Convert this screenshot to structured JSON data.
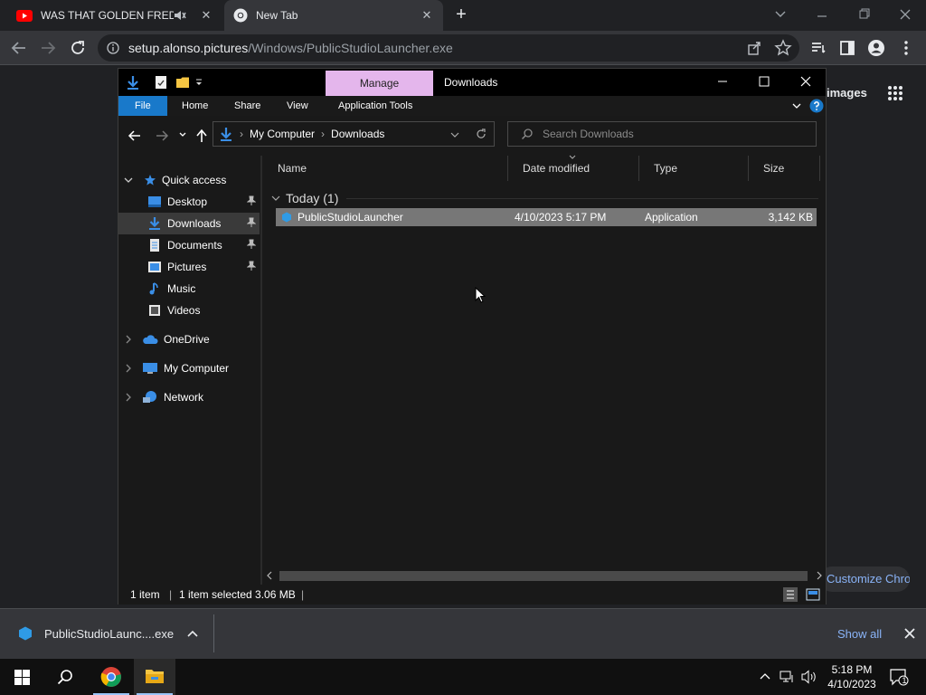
{
  "chrome": {
    "tabs": [
      {
        "title": "WAS THAT GOLDEN FREDDY",
        "close": "✕"
      },
      {
        "title": "New Tab",
        "close": "✕"
      }
    ],
    "new_tab": "+",
    "url_host": "setup.alonso.pictures",
    "url_path": "/Windows/PublicStudioLauncher.exe",
    "images_link": "images",
    "customize_label": "Customize Chrome"
  },
  "explorer": {
    "ribbon_manage": "Manage",
    "title": "Downloads",
    "ribbon_tabs": [
      "File",
      "Home",
      "Share",
      "View",
      "Application Tools"
    ],
    "breadcrumb": [
      "My Computer",
      "Downloads"
    ],
    "search_placeholder": "Search Downloads",
    "nav": {
      "quick_access": "Quick access",
      "items": [
        "Desktop",
        "Downloads",
        "Documents",
        "Pictures",
        "Music",
        "Videos"
      ],
      "onedrive": "OneDrive",
      "my_computer": "My Computer",
      "network": "Network"
    },
    "columns": [
      "Name",
      "Date modified",
      "Type",
      "Size"
    ],
    "group": "Today (1)",
    "file": {
      "name": "PublicStudioLauncher",
      "date": "4/10/2023 5:17 PM",
      "type": "Application",
      "size": "3,142 KB"
    },
    "status": {
      "count": "1 item",
      "selected": "1 item selected  3.06 MB"
    }
  },
  "download_shelf": {
    "file": "PublicStudioLaunc....exe",
    "show_all": "Show all"
  },
  "taskbar": {
    "time": "5:18 PM",
    "date": "4/10/2023",
    "notifications": "1"
  },
  "colors": {
    "chrome_dark": "#202124",
    "chrome_toolbar": "#35363a",
    "manage_tab": "#e4b6ec",
    "file_tab": "#1979ca",
    "link_blue": "#8ab4f8"
  }
}
